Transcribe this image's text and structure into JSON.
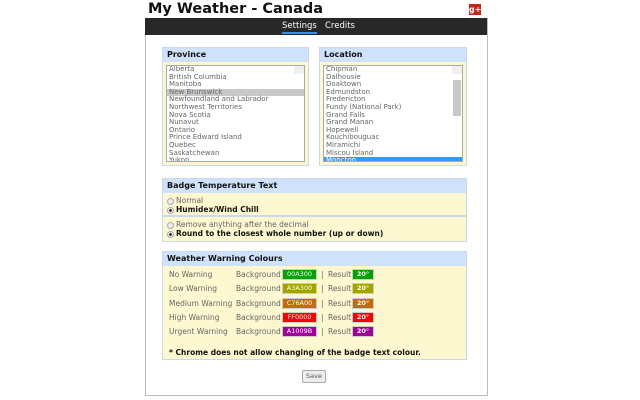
{
  "title": "My Weather - Canada",
  "tabs": [
    "Settings",
    "Credits"
  ],
  "province": {
    "header": "Province",
    "items": [
      "Alberta",
      "British Columbia",
      "Manitoba",
      "New Brunswick",
      "Newfoundland and Labrador",
      "Northwest Territories",
      "Nova Scotia",
      "Nunavut",
      "Ontario",
      "Prince Edward Island",
      "Quebec",
      "Saskatchewan",
      "Yukon"
    ],
    "selected": "New Brunswick"
  },
  "location": {
    "header": "Location",
    "items": [
      "Chipman",
      "Dalhousie",
      "Doaktown",
      "Edmundston",
      "Fredericton",
      "Fundy (National Park)",
      "Grand Falls",
      "Grand Manan",
      "Hopewell",
      "Kouchibouguac",
      "Miramichi",
      "Miscou Island",
      "Moncton"
    ],
    "selected": "Moncton"
  },
  "badge": {
    "header": "Badge Temperature Text",
    "opt1": "Normal",
    "opt2": "Humidex/Wind Chill",
    "opt3": "Remove anything after the decimal",
    "opt4": "Round to the closest whole number (up or down)"
  },
  "warnings": {
    "header": "Weather Warning Colours",
    "background_label": "Background",
    "result_label": "Result",
    "sep": "|",
    "result_text": "20°",
    "rows": [
      {
        "label": "No Warning",
        "hex": "00A300",
        "color": "#00A300"
      },
      {
        "label": "Low Warning",
        "hex": "A3A300",
        "color": "#A3A300"
      },
      {
        "label": "Medium Warning",
        "hex": "C76A00",
        "color": "#C76A00"
      },
      {
        "label": "High Warning",
        "hex": "FF0000",
        "color": "#FF0000"
      },
      {
        "label": "Urgent Warning",
        "hex": "A1009B",
        "color": "#A1009B"
      }
    ],
    "note": "* Chrome does not allow changing of the badge text colour."
  },
  "save": "Save"
}
